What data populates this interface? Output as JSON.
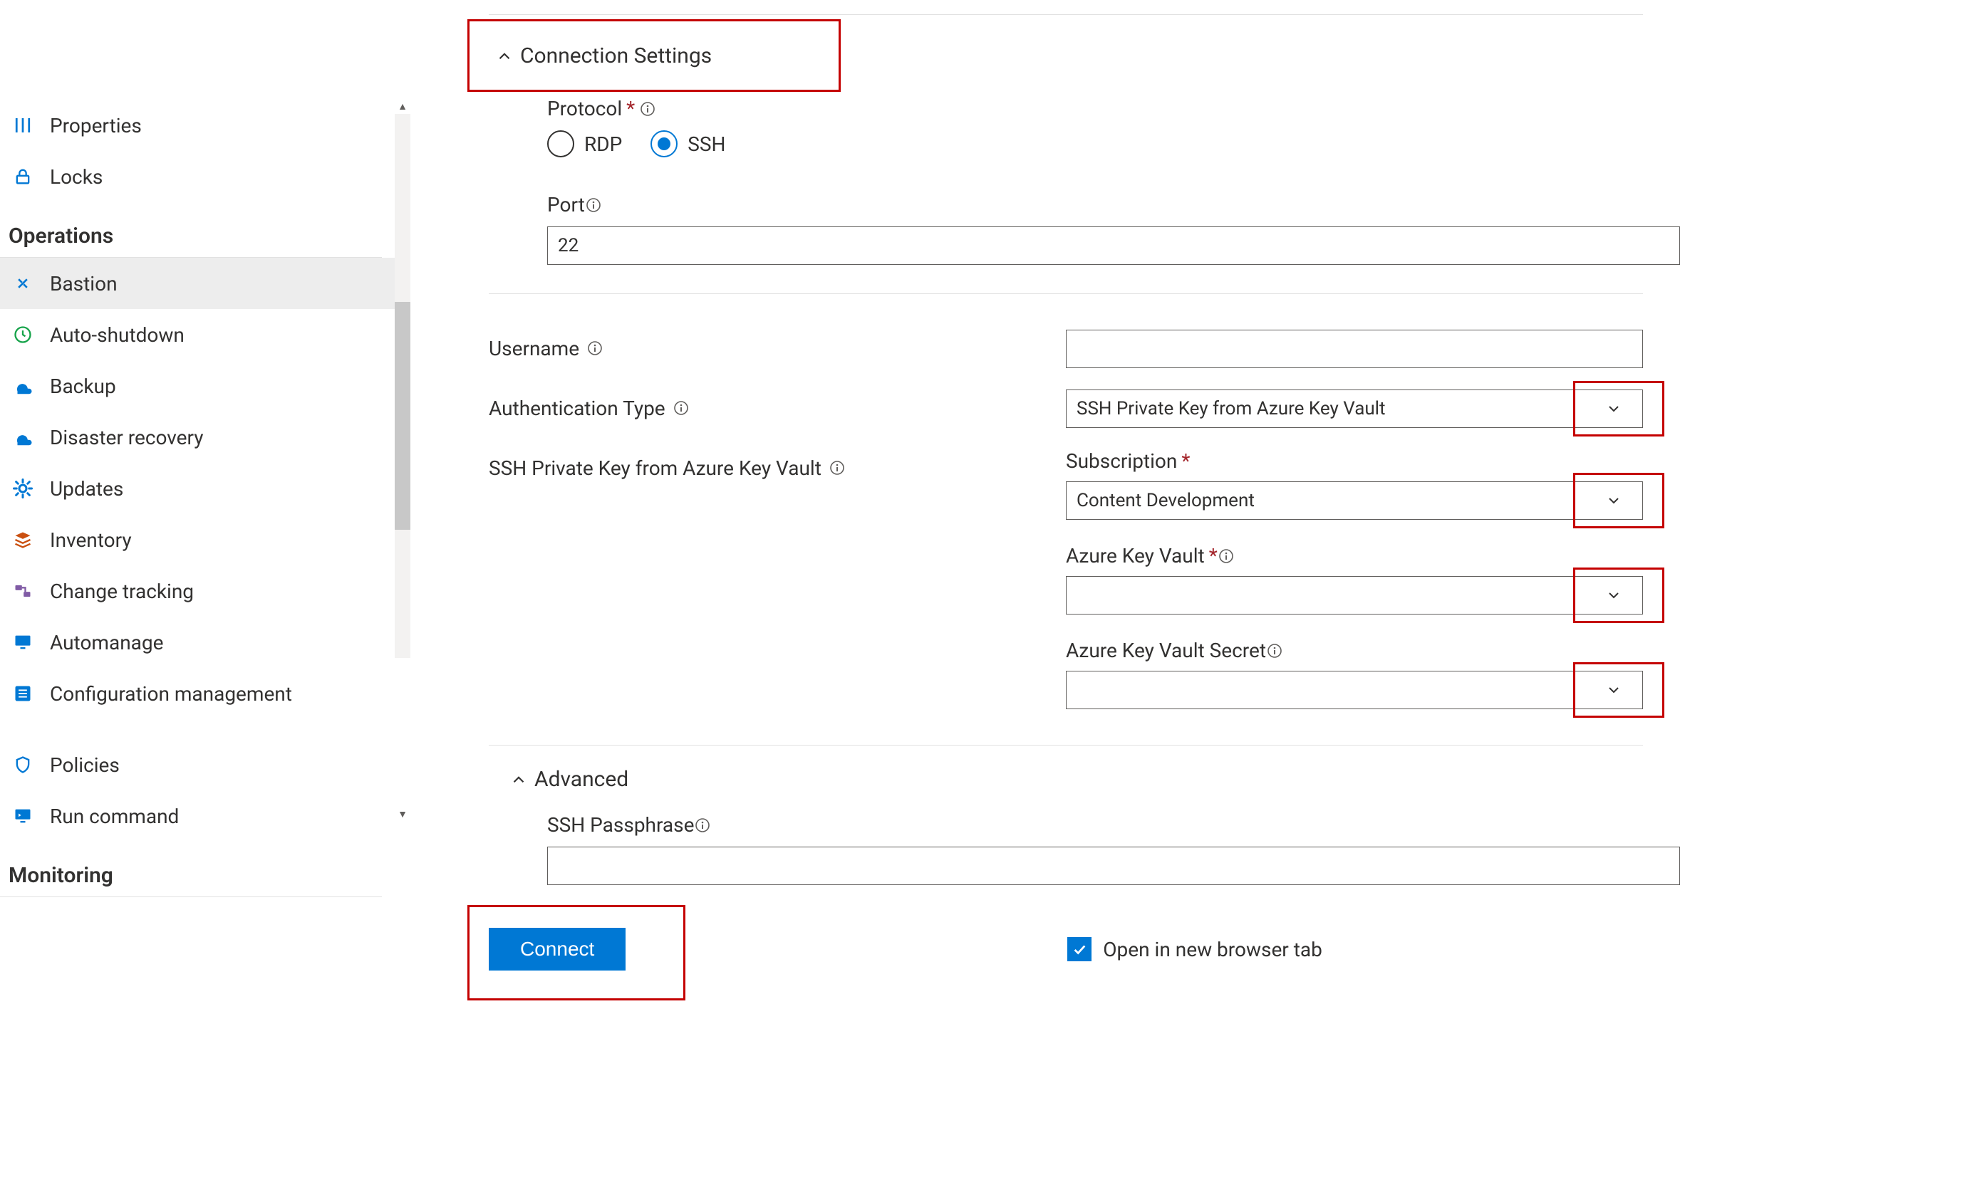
{
  "sidebar": {
    "items_top": [
      {
        "label": "Properties"
      },
      {
        "label": "Locks"
      }
    ],
    "operations_header": "Operations",
    "items_ops": [
      {
        "label": "Bastion",
        "selected": true
      },
      {
        "label": "Auto-shutdown"
      },
      {
        "label": "Backup"
      },
      {
        "label": "Disaster recovery"
      },
      {
        "label": "Updates"
      },
      {
        "label": "Inventory"
      },
      {
        "label": "Change tracking"
      },
      {
        "label": "Automanage"
      },
      {
        "label": "Configuration management"
      }
    ],
    "items_ops2": [
      {
        "label": "Policies"
      },
      {
        "label": "Run command"
      }
    ],
    "monitoring_header": "Monitoring"
  },
  "form": {
    "connection_settings_header": "Connection Settings",
    "protocol_label": "Protocol",
    "protocol_rdp": "RDP",
    "protocol_ssh": "SSH",
    "protocol_selected": "SSH",
    "port_label": "Port",
    "port_value": "22",
    "username_label": "Username",
    "username_value": "",
    "auth_type_label": "Authentication Type",
    "auth_type_value": "SSH Private Key from Azure Key Vault",
    "ssh_kv_label": "SSH Private Key from Azure Key Vault",
    "subscription_label": "Subscription",
    "subscription_value": "Content Development",
    "akv_label": "Azure Key Vault",
    "akv_value": "",
    "akv_secret_label": "Azure Key Vault Secret",
    "akv_secret_value": "",
    "advanced_header": "Advanced",
    "ssh_passphrase_label": "SSH Passphrase",
    "ssh_passphrase_value": "",
    "open_new_tab_label": "Open in new browser tab",
    "open_new_tab_checked": true,
    "connect_button": "Connect"
  }
}
